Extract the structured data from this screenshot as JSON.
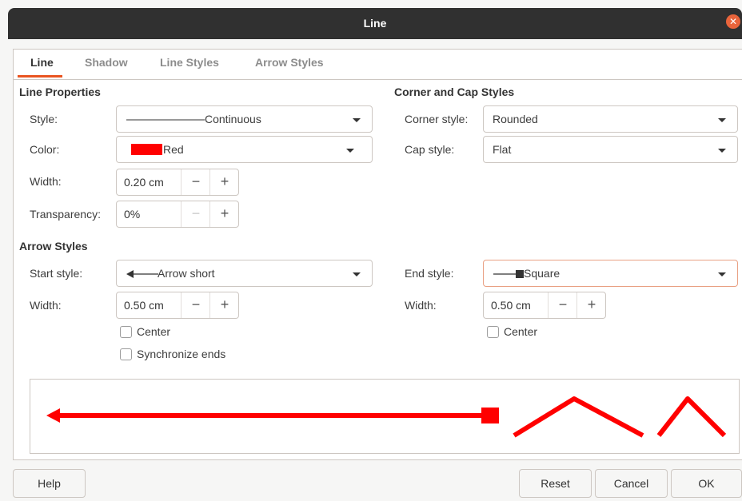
{
  "window": {
    "title": "Line",
    "close_symbol": "✕"
  },
  "tabs": [
    {
      "label": "Line"
    },
    {
      "label": "Shadow"
    },
    {
      "label": "Line Styles"
    },
    {
      "label": "Arrow Styles"
    }
  ],
  "line_properties": {
    "title": "Line Properties",
    "style_label": "Style:",
    "style_value": "Continuous",
    "color_label": "Color:",
    "color_value": "Red",
    "color_swatch": "#ff0000",
    "width_label": "Width:",
    "width_value": "0.20 cm",
    "transparency_label": "Transparency:",
    "transparency_value": "0%"
  },
  "corner_cap": {
    "title": "Corner and Cap Styles",
    "corner_label": "Corner style:",
    "corner_value": "Rounded",
    "cap_label": "Cap style:",
    "cap_value": "Flat"
  },
  "arrow_styles": {
    "title": "Arrow Styles",
    "start_label": "Start style:",
    "start_value": "Arrow short",
    "start_width_label": "Width:",
    "start_width_value": "0.50 cm",
    "start_center_label": "Center",
    "sync_label": "Synchronize ends",
    "end_label": "End style:",
    "end_value": "Square",
    "end_width_label": "Width:",
    "end_width_value": "0.50 cm",
    "end_center_label": "Center"
  },
  "spin": {
    "minus": "−",
    "plus": "+"
  },
  "buttons": {
    "help": "Help",
    "reset": "Reset",
    "cancel": "Cancel",
    "ok": "OK"
  },
  "colors": {
    "accent": "#e95420",
    "preview_line": "#ff0000"
  }
}
